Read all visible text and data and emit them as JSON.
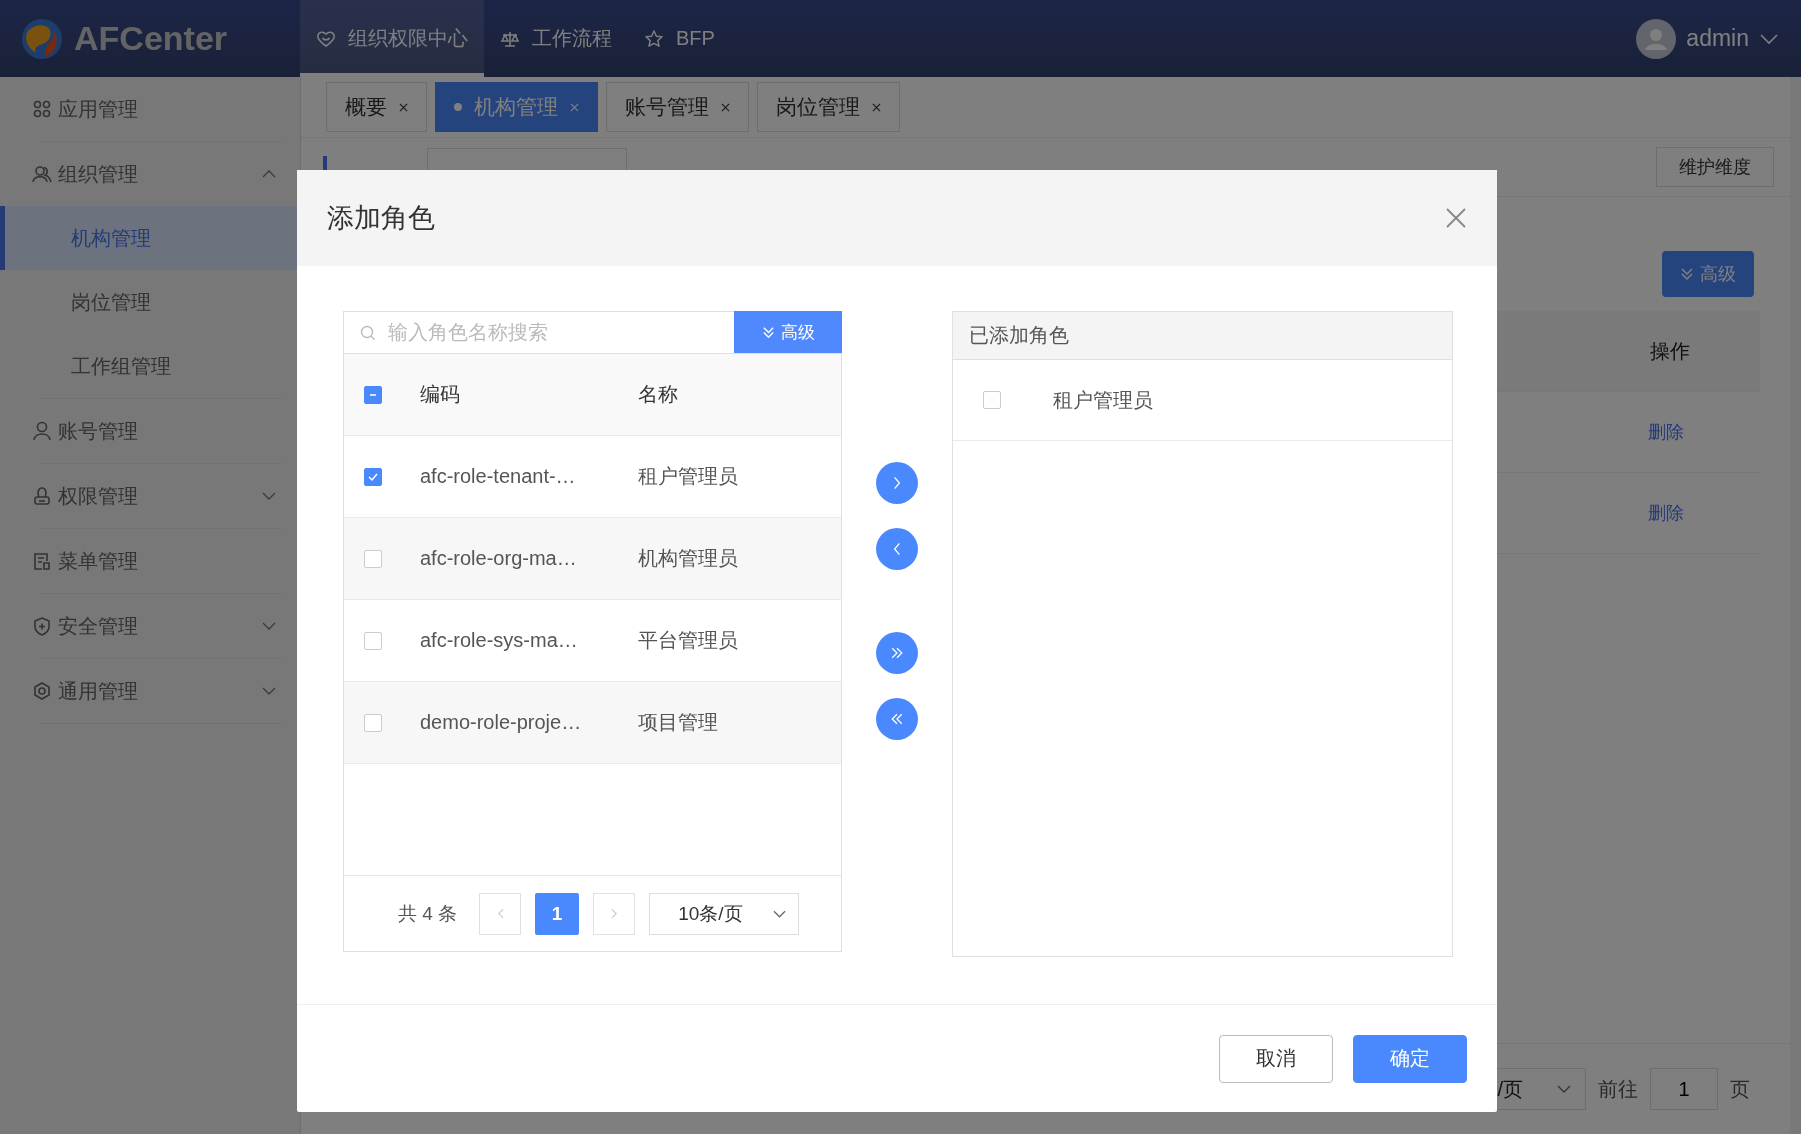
{
  "header": {
    "logo": "AFCenter",
    "nav": [
      {
        "label": "组织权限中心",
        "selected": true
      },
      {
        "label": "工作流程",
        "selected": false
      },
      {
        "label": "BFP",
        "selected": false
      }
    ],
    "user": "admin"
  },
  "sidebar": {
    "items": [
      {
        "label": "应用管理"
      },
      {
        "label": "组织管理",
        "expanded": true,
        "children": [
          {
            "label": "机构管理",
            "selected": true
          },
          {
            "label": "岗位管理",
            "selected": false
          },
          {
            "label": "工作组管理",
            "selected": false
          }
        ]
      },
      {
        "label": "账号管理"
      },
      {
        "label": "权限管理",
        "expanded": false
      },
      {
        "label": "菜单管理"
      },
      {
        "label": "安全管理",
        "expanded": false
      },
      {
        "label": "通用管理",
        "expanded": false
      }
    ]
  },
  "tabs": [
    {
      "label": "概要",
      "selected": false
    },
    {
      "label": "机构管理",
      "selected": true
    },
    {
      "label": "账号管理",
      "selected": false
    },
    {
      "label": "岗位管理",
      "selected": false
    }
  ],
  "dimension": {
    "button": "维护维度"
  },
  "advanced_button": "高级",
  "table": {
    "columns": [
      "操作"
    ],
    "rows": [
      {
        "action": "删除"
      },
      {
        "action": "删除"
      }
    ]
  },
  "pagination": {
    "page_size": "/页",
    "goto_label": "前往",
    "page": "1",
    "page_suffix": "页"
  },
  "dialog": {
    "title": "添加角色",
    "source": {
      "search_placeholder": "输入角色名称搜索",
      "advanced_button": "高级",
      "columns": [
        "编码",
        "名称"
      ],
      "select_all_indeterminate": true,
      "rows": [
        {
          "code": "afc-role-tenant-…",
          "name": "租户管理员",
          "checked": true
        },
        {
          "code": "afc-role-org-ma…",
          "name": "机构管理员",
          "checked": false
        },
        {
          "code": "afc-role-sys-ma…",
          "name": "平台管理员",
          "checked": false
        },
        {
          "code": "demo-role-proje…",
          "name": "项目管理",
          "checked": false
        }
      ],
      "pagination": {
        "total": "共 4 条",
        "pages": [
          {
            "label": "1",
            "selected": true
          }
        ],
        "page_size": "10条/页"
      }
    },
    "target": {
      "title": "已添加角色",
      "rows": [
        {
          "name": "租户管理员",
          "checked": false
        }
      ]
    },
    "buttons": [
      {
        "label": "取消",
        "kind": "secondary"
      },
      {
        "label": "确定",
        "kind": "primary"
      }
    ]
  }
}
